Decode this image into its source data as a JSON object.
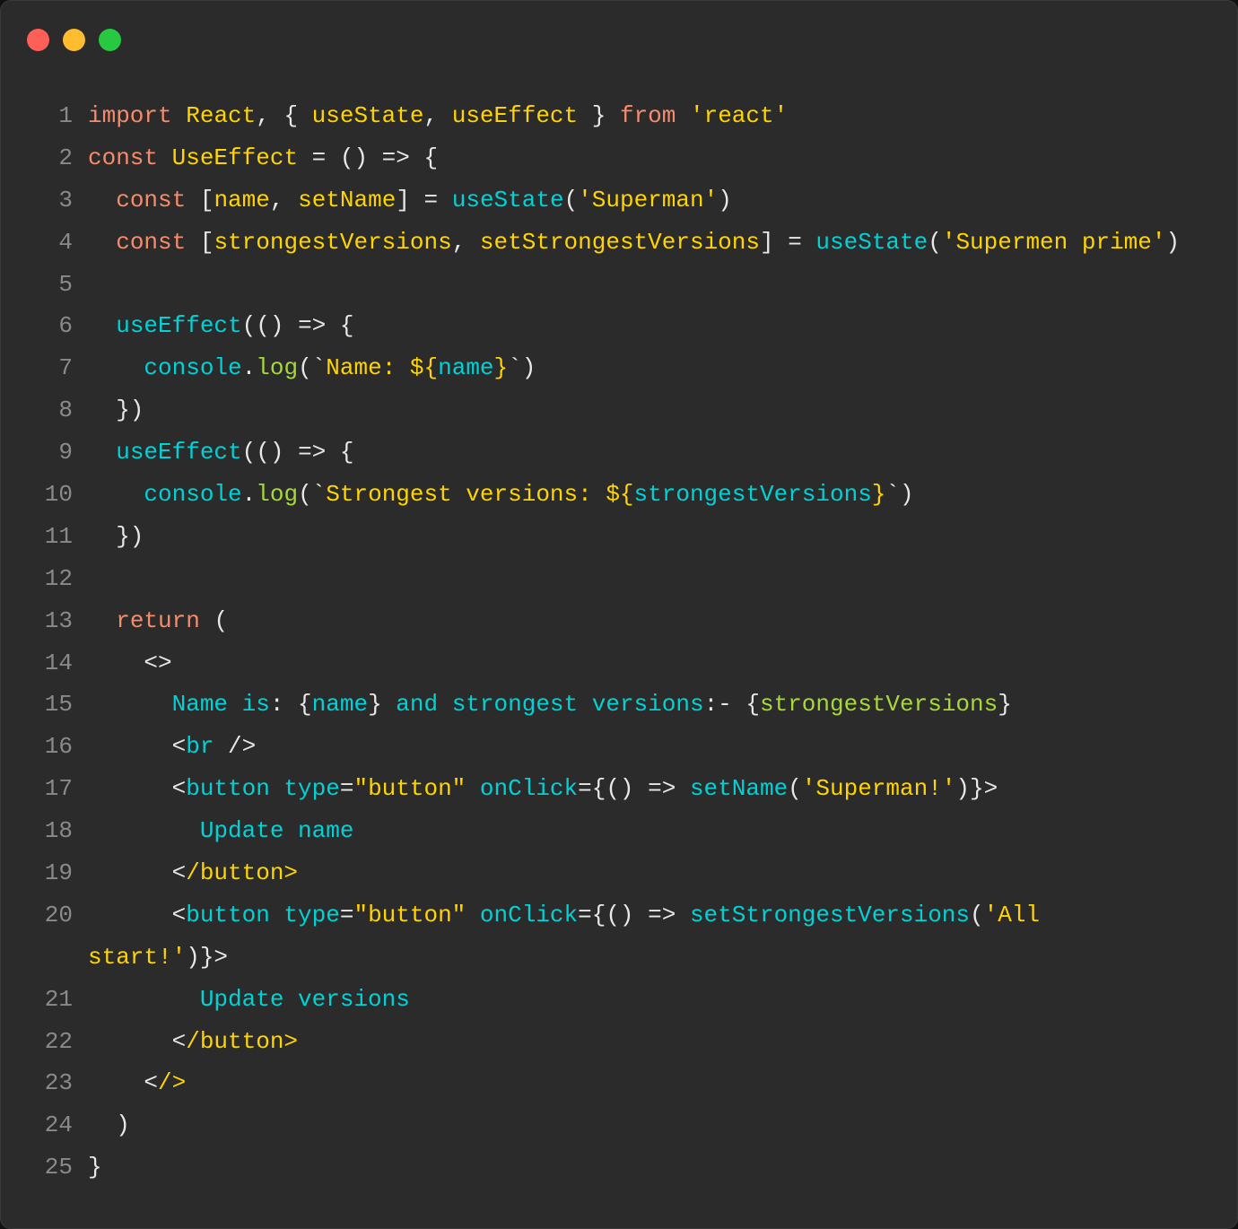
{
  "window": {
    "traffic_lights": [
      {
        "name": "close",
        "color": "#ff5f57"
      },
      {
        "name": "minimize",
        "color": "#febc2e"
      },
      {
        "name": "maximize",
        "color": "#28c840"
      }
    ]
  },
  "colors": {
    "k": "#f78c6c",
    "y": "#ffd400",
    "c": "#00d2d6",
    "w": "#e8e8e8",
    "g": "#a7d83a"
  },
  "lines": [
    {
      "n": "1",
      "t": [
        [
          "import",
          "k"
        ],
        [
          " ",
          "w"
        ],
        [
          "React",
          "y"
        ],
        [
          ", { ",
          "w"
        ],
        [
          "useState",
          "y"
        ],
        [
          ", ",
          "w"
        ],
        [
          "useEffect",
          "y"
        ],
        [
          " } ",
          "w"
        ],
        [
          "from",
          "k"
        ],
        [
          " ",
          "w"
        ],
        [
          "'react'",
          "y"
        ]
      ]
    },
    {
      "n": "2",
      "t": [
        [
          "const",
          "k"
        ],
        [
          " ",
          "w"
        ],
        [
          "UseEffect",
          "y"
        ],
        [
          " = () => {",
          "w"
        ]
      ]
    },
    {
      "n": "3",
      "t": [
        [
          "  ",
          "w"
        ],
        [
          "const",
          "k"
        ],
        [
          " [",
          "w"
        ],
        [
          "name",
          "y"
        ],
        [
          ", ",
          "w"
        ],
        [
          "setName",
          "y"
        ],
        [
          "] = ",
          "w"
        ],
        [
          "useState",
          "c"
        ],
        [
          "(",
          "w"
        ],
        [
          "'Superman'",
          "y"
        ],
        [
          ")",
          "w"
        ]
      ]
    },
    {
      "n": "4",
      "t": [
        [
          "  ",
          "w"
        ],
        [
          "const",
          "k"
        ],
        [
          " [",
          "w"
        ],
        [
          "strongestVersions",
          "y"
        ],
        [
          ", ",
          "w"
        ],
        [
          "setStrongestVersions",
          "y"
        ],
        [
          "] = ",
          "w"
        ],
        [
          "useState",
          "c"
        ],
        [
          "(",
          "w"
        ],
        [
          "'Supermen prime'",
          "y"
        ],
        [
          ")",
          "w"
        ]
      ]
    },
    {
      "n": "5",
      "t": []
    },
    {
      "n": "6",
      "t": [
        [
          "  ",
          "w"
        ],
        [
          "useEffect",
          "c"
        ],
        [
          "(() => {",
          "w"
        ]
      ]
    },
    {
      "n": "7",
      "t": [
        [
          "    ",
          "w"
        ],
        [
          "console",
          "c"
        ],
        [
          ".",
          "w"
        ],
        [
          "log",
          "g"
        ],
        [
          "(`",
          "w"
        ],
        [
          "Name: ${",
          "y"
        ],
        [
          "name",
          "c"
        ],
        [
          "}",
          "y"
        ],
        [
          "`)",
          "w"
        ]
      ]
    },
    {
      "n": "8",
      "t": [
        [
          "  })",
          "w"
        ]
      ]
    },
    {
      "n": "9",
      "t": [
        [
          "  ",
          "w"
        ],
        [
          "useEffect",
          "c"
        ],
        [
          "(() => {",
          "w"
        ]
      ]
    },
    {
      "n": "10",
      "t": [
        [
          "    ",
          "w"
        ],
        [
          "console",
          "c"
        ],
        [
          ".",
          "w"
        ],
        [
          "log",
          "g"
        ],
        [
          "(`",
          "w"
        ],
        [
          "Strongest versions: ${",
          "y"
        ],
        [
          "strongestVersions",
          "c"
        ],
        [
          "}",
          "y"
        ],
        [
          "`)",
          "w"
        ]
      ]
    },
    {
      "n": "11",
      "t": [
        [
          "  })",
          "w"
        ]
      ]
    },
    {
      "n": "12",
      "t": []
    },
    {
      "n": "13",
      "t": [
        [
          "  ",
          "w"
        ],
        [
          "return",
          "k"
        ],
        [
          " (",
          "w"
        ]
      ]
    },
    {
      "n": "14",
      "t": [
        [
          "    <>",
          "w"
        ]
      ]
    },
    {
      "n": "15",
      "t": [
        [
          "      ",
          "w"
        ],
        [
          "Name is",
          "c"
        ],
        [
          ": {",
          "w"
        ],
        [
          "name",
          "c"
        ],
        [
          "} ",
          "w"
        ],
        [
          "and strongest versions",
          "c"
        ],
        [
          ":- {",
          "w"
        ],
        [
          "strongestVersions",
          "g"
        ],
        [
          "}",
          "w"
        ]
      ]
    },
    {
      "n": "16",
      "t": [
        [
          "      <",
          "w"
        ],
        [
          "br",
          "c"
        ],
        [
          " />",
          "w"
        ]
      ]
    },
    {
      "n": "17",
      "t": [
        [
          "      <",
          "w"
        ],
        [
          "button type",
          "c"
        ],
        [
          "=",
          "w"
        ],
        [
          "\"button\"",
          "y"
        ],
        [
          " ",
          "w"
        ],
        [
          "onClick",
          "c"
        ],
        [
          "={() => ",
          "w"
        ],
        [
          "setName",
          "c"
        ],
        [
          "(",
          "w"
        ],
        [
          "'Superman!'",
          "y"
        ],
        [
          ")}>",
          "w"
        ]
      ]
    },
    {
      "n": "18",
      "t": [
        [
          "        Update name",
          "c"
        ]
      ]
    },
    {
      "n": "19",
      "t": [
        [
          "      <",
          "w"
        ],
        [
          "/button>",
          "y"
        ]
      ]
    },
    {
      "n": "20",
      "t": [
        [
          "      <",
          "w"
        ],
        [
          "button type",
          "c"
        ],
        [
          "=",
          "w"
        ],
        [
          "\"button\"",
          "y"
        ],
        [
          " ",
          "w"
        ],
        [
          "onClick",
          "c"
        ],
        [
          "={() => ",
          "w"
        ],
        [
          "setStrongestVersions",
          "c"
        ],
        [
          "(",
          "w"
        ],
        [
          "'All",
          "y"
        ]
      ]
    },
    {
      "n": "",
      "t": [
        [
          "start!'",
          "y"
        ],
        [
          ")}>",
          "w"
        ]
      ]
    },
    {
      "n": "21",
      "t": [
        [
          "        Update versions",
          "c"
        ]
      ]
    },
    {
      "n": "22",
      "t": [
        [
          "      <",
          "w"
        ],
        [
          "/button>",
          "y"
        ]
      ]
    },
    {
      "n": "23",
      "t": [
        [
          "    <",
          "w"
        ],
        [
          "/>",
          "y"
        ]
      ]
    },
    {
      "n": "24",
      "t": [
        [
          "  )",
          "w"
        ]
      ]
    },
    {
      "n": "25",
      "t": [
        [
          "}",
          "w"
        ]
      ]
    }
  ]
}
